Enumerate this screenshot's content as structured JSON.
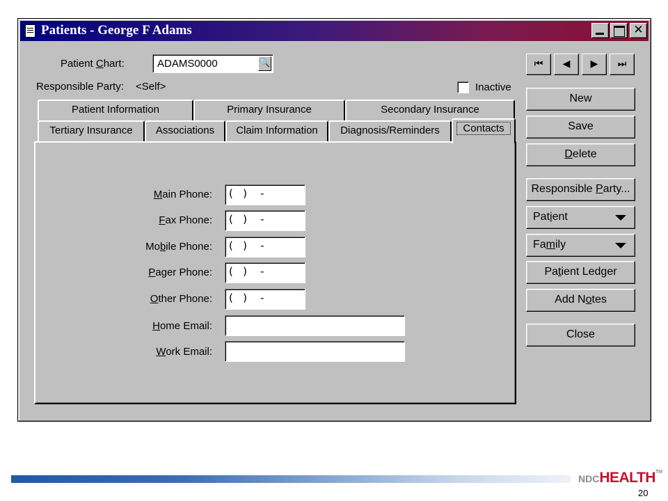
{
  "window": {
    "title": "Patients - George F Adams",
    "title_icon": "document-icon",
    "controls": {
      "minimize": "minimize-icon",
      "maximize": "maximize-icon",
      "close": "✕"
    }
  },
  "header": {
    "patient_chart_label": "Patient ",
    "patient_chart_label_u": "C",
    "patient_chart_label_rest": "hart:",
    "patient_chart_value": "ADAMS0000",
    "lookup_icon": "magnifier-icon",
    "responsible_party_label": "Responsible Party:",
    "responsible_party_value": "<Self>",
    "inactive_label": "Inactive",
    "inactive_checked": false
  },
  "tabs": {
    "row_back": [
      "Patient Information",
      "Primary Insurance",
      "Secondary Insurance"
    ],
    "row_front": [
      "Tertiary Insurance",
      "Associations",
      "Claim Information",
      "Diagnosis/Reminders",
      "Contacts"
    ],
    "active": "Contacts"
  },
  "contacts": {
    "main_phone": {
      "u": "M",
      "rest": "ain Phone:",
      "value": "(   )    -"
    },
    "fax_phone": {
      "u": "F",
      "rest": "ax Phone:",
      "value": "(   )    -"
    },
    "mobile_phone": {
      "pre": "Mo",
      "u": "b",
      "rest": "ile Phone:",
      "value": "(   )    -"
    },
    "pager_phone": {
      "u": "P",
      "rest": "ager Phone:",
      "value": "(   )    -"
    },
    "other_phone": {
      "u": "O",
      "rest": "ther Phone:",
      "value": "(   )    -"
    },
    "home_email": {
      "u": "H",
      "rest": "ome Email:",
      "value": ""
    },
    "work_email": {
      "u": "W",
      "rest": "ork Email:",
      "value": ""
    }
  },
  "navigation": {
    "first": "⏮",
    "prev": "◀",
    "next": "▶",
    "last": "⏭"
  },
  "buttons": {
    "new": "New",
    "save": "Save",
    "delete_u": "D",
    "delete_rest": "elete",
    "responsible_party_pre": "Responsible ",
    "responsible_party_u": "P",
    "responsible_party_rest": "arty...",
    "patient_pre": "Pat",
    "patient_u": "i",
    "patient_rest": "ent",
    "family_pre": "Fa",
    "family_u": "m",
    "family_rest": "ily",
    "ledger_pre": "Pa",
    "ledger_u": "t",
    "ledger_rest": "ient Ledger",
    "notes_pre": "Add N",
    "notes_u": "o",
    "notes_rest": "tes",
    "close": "Close"
  },
  "footer": {
    "logo_ndc": "NDC",
    "logo_health": "HEALTH",
    "logo_tm": "TM",
    "page_number": "20",
    "accent_color": "#c8102e"
  }
}
